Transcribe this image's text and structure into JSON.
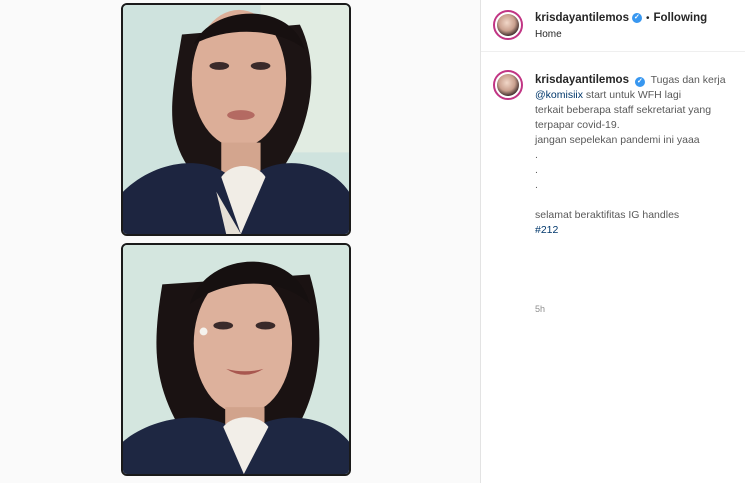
{
  "header": {
    "username": "krisdayantilemos",
    "separator": "•",
    "follow_status": "Following",
    "location": "Home"
  },
  "post": {
    "username": "krisdayantilemos",
    "caption_lines": [
      "Tugas dan kerja",
      "@komisiix",
      "start untuk WFH lagi",
      "terkait beberapa staff sekretariat yang",
      "terpapar covid-19.",
      "jangan sepelekan pandemi ini yaaa",
      ".",
      ".",
      ".",
      "selamat beraktifitas IG handles",
      "#212"
    ],
    "time": "5h"
  },
  "icons": {
    "verified": "verified-badge-icon"
  },
  "colors": {
    "link": "#00376b",
    "verified": "#3897f0",
    "avatar_ring": "#c13584"
  }
}
